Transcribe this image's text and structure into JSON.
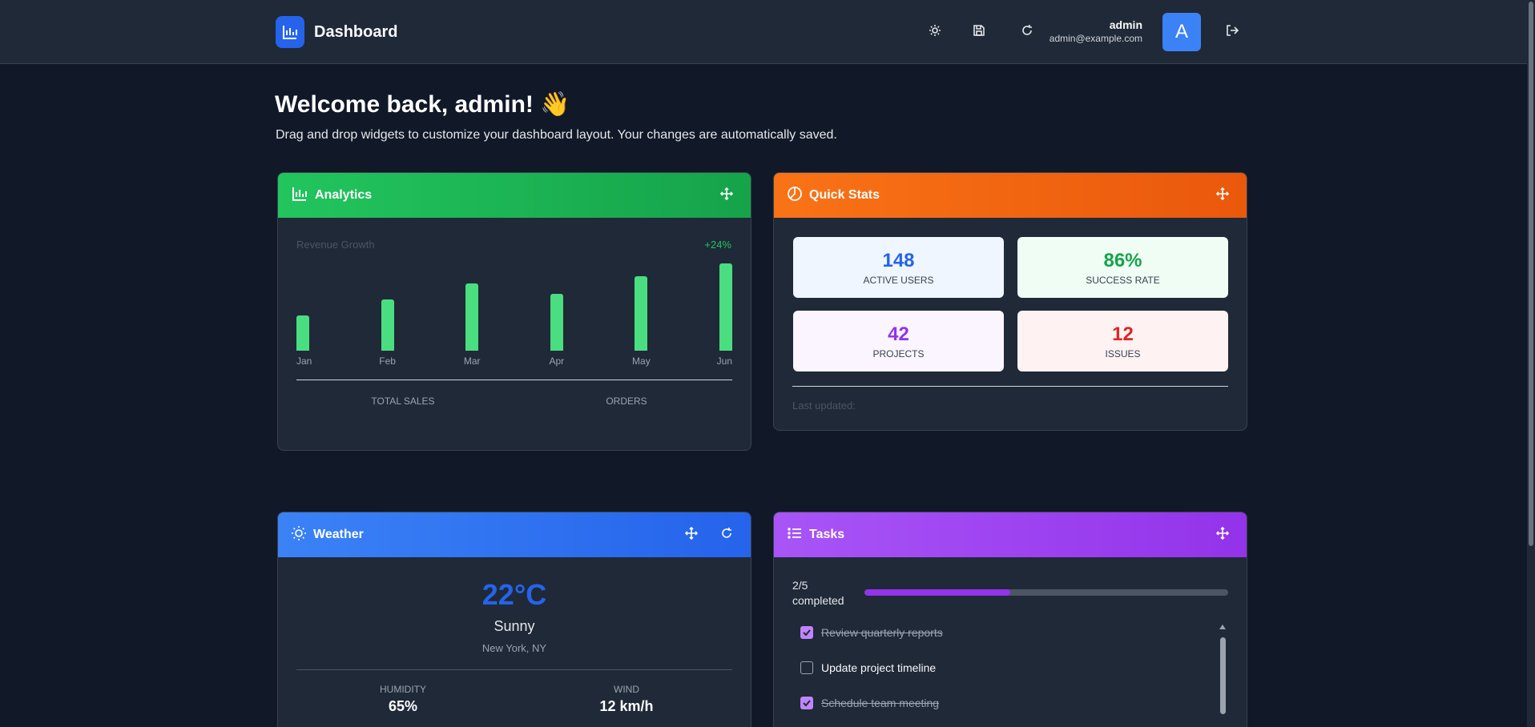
{
  "header": {
    "brand_title": "Dashboard",
    "user_name": "admin",
    "user_email": "admin@example.com",
    "avatar_initial": "A",
    "icons": [
      "chart-icon",
      "sun-icon",
      "save-icon",
      "refresh-icon",
      "logout-icon"
    ]
  },
  "welcome": {
    "title": "Welcome back, admin! 👋",
    "subtitle": "Drag and drop widgets to customize your dashboard layout. Your changes are automatically saved."
  },
  "analytics": {
    "title": "Analytics",
    "revenue_label": "Revenue Growth",
    "growth": "+24%",
    "total_sales_label": "TOTAL SALES",
    "orders_label": "ORDERS",
    "accent": "#22c55e",
    "chart_data": {
      "type": "bar",
      "categories": [
        "Jan",
        "Feb",
        "Mar",
        "Apr",
        "May",
        "Jun"
      ],
      "values": [
        40,
        58,
        76,
        65,
        85,
        99
      ],
      "ylim": [
        0,
        100
      ]
    }
  },
  "quick_stats": {
    "title": "Quick Stats",
    "cards": [
      {
        "value": "148",
        "label": "ACTIVE USERS",
        "color": "#2563eb",
        "bg": "#eff6ff"
      },
      {
        "value": "86%",
        "label": "SUCCESS RATE",
        "color": "#16a34a",
        "bg": "#f0fdf4"
      },
      {
        "value": "42",
        "label": "PROJECTS",
        "color": "#9333ea",
        "bg": "#faf5ff"
      },
      {
        "value": "12",
        "label": "ISSUES",
        "color": "#dc2626",
        "bg": "#fef2f2"
      }
    ],
    "last_updated": "Last updated:"
  },
  "weather": {
    "title": "Weather",
    "temperature": "22°C",
    "condition": "Sunny",
    "location": "New York, NY",
    "humidity_label": "HUMIDITY",
    "humidity_value": "65%",
    "wind_label": "WIND",
    "wind_value": "12 km/h"
  },
  "tasks": {
    "title": "Tasks",
    "progress_text": "2/5 completed",
    "progress_fraction": 0.4,
    "items": [
      {
        "label": "Review quarterly reports",
        "done": true
      },
      {
        "label": "Update project timeline",
        "done": false
      },
      {
        "label": "Schedule team meeting",
        "done": true
      }
    ]
  }
}
